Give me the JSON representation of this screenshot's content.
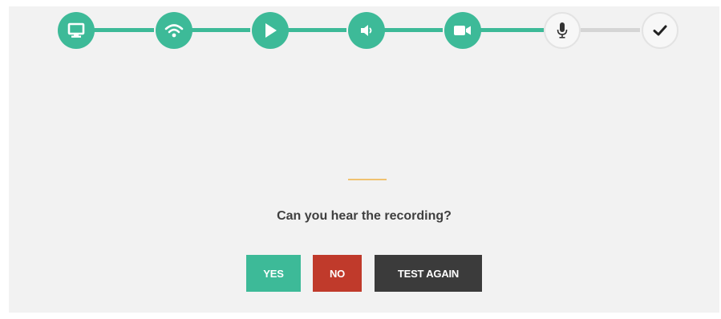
{
  "stepper": {
    "steps": [
      {
        "icon": "monitor-icon",
        "state": "done"
      },
      {
        "icon": "wifi-icon",
        "state": "done"
      },
      {
        "icon": "play-icon",
        "state": "done"
      },
      {
        "icon": "speaker-icon",
        "state": "done"
      },
      {
        "icon": "video-camera-icon",
        "state": "done"
      },
      {
        "icon": "microphone-icon",
        "state": "current"
      },
      {
        "icon": "checkmark-icon",
        "state": "todo"
      }
    ],
    "colors": {
      "done": "#3dba98",
      "pending": "#d5d5d5"
    }
  },
  "prompt": {
    "question": "Can you hear the recording?"
  },
  "buttons": {
    "yes_label": "YES",
    "no_label": "NO",
    "test_again_label": "TEST AGAIN"
  },
  "colors": {
    "accent_green": "#3dba98",
    "no_red": "#c03a2b",
    "dark_button": "#3b3b3b",
    "divider_gold": "#f0c270",
    "background": "#f2f2f2"
  }
}
